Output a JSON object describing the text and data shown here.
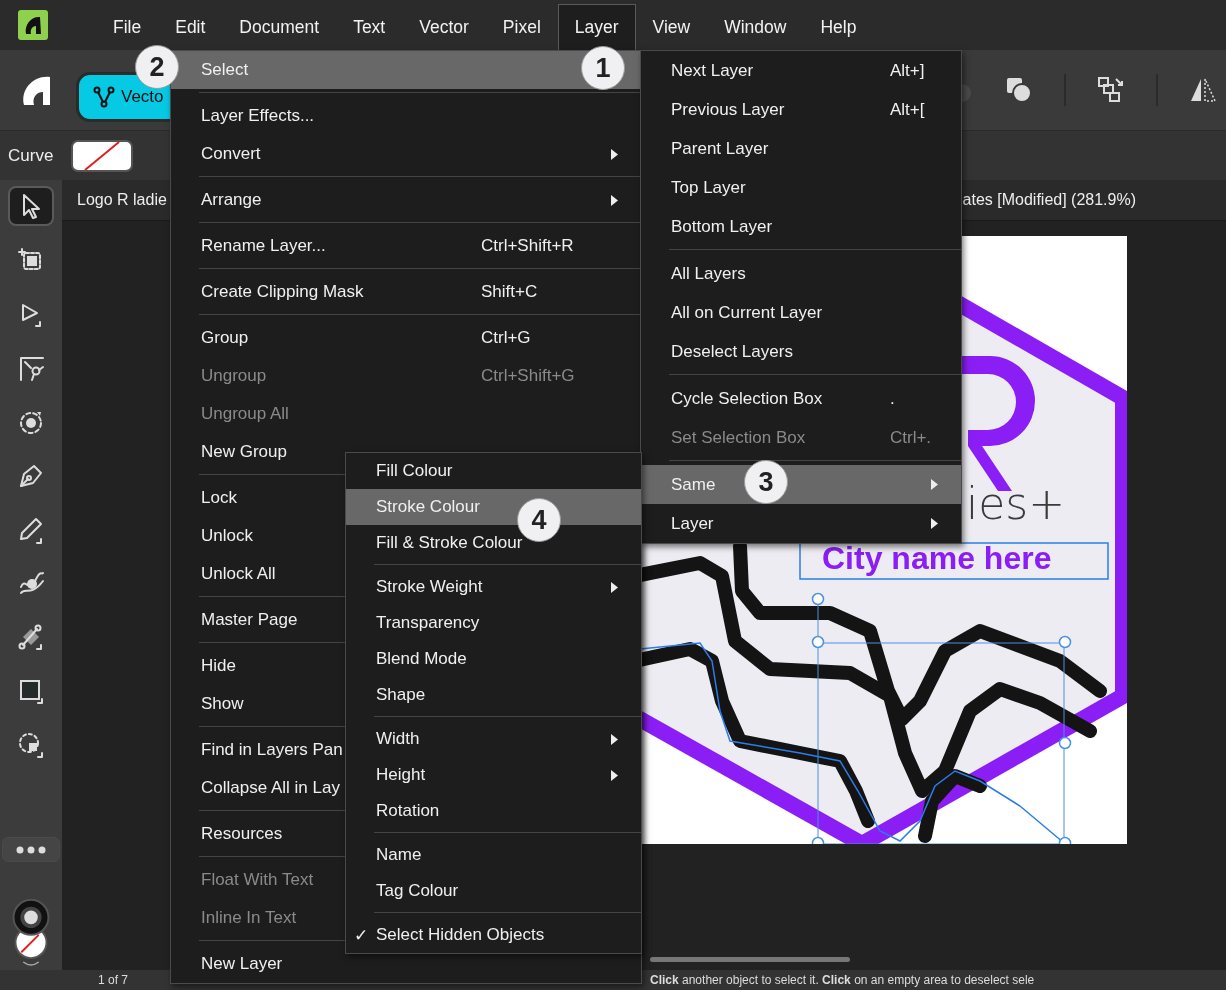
{
  "menu_bar": {
    "items": [
      {
        "label": "File",
        "selected": false
      },
      {
        "label": "Edit",
        "selected": false
      },
      {
        "label": "Document",
        "selected": false
      },
      {
        "label": "Text",
        "selected": false
      },
      {
        "label": "Vector",
        "selected": false
      },
      {
        "label": "Pixel",
        "selected": false
      },
      {
        "label": "Layer",
        "selected": true
      },
      {
        "label": "View",
        "selected": false
      },
      {
        "label": "Window",
        "selected": false
      },
      {
        "label": "Help",
        "selected": false
      }
    ]
  },
  "toolbar": {
    "persona_button": "Vecto"
  },
  "context_bar": {
    "tool_label": "Curve"
  },
  "tools": [
    {
      "kind": "move",
      "selected": true
    },
    {
      "kind": "artboard",
      "selected": false
    },
    {
      "kind": "node",
      "selected": false
    },
    {
      "kind": "corner",
      "selected": false
    },
    {
      "kind": "point",
      "selected": false
    },
    {
      "kind": "pen",
      "selected": false
    },
    {
      "kind": "pencil",
      "selected": false
    },
    {
      "kind": "vector-brush",
      "selected": false
    },
    {
      "kind": "gradient",
      "selected": false
    },
    {
      "kind": "rectangle",
      "selected": false
    },
    {
      "kind": "selection",
      "selected": false
    }
  ],
  "document_tabs": {
    "left_title": "Logo R ladie",
    "right_title": "ates [Modified] (281.9%)"
  },
  "layer_menu": {
    "items": [
      {
        "kind": "item",
        "label": "Select",
        "selected": true,
        "disabled": false
      },
      {
        "kind": "separator"
      },
      {
        "kind": "item",
        "label": "Layer Effects...",
        "selected": false,
        "disabled": false
      },
      {
        "kind": "item",
        "label": "Convert",
        "selected": false,
        "disabled": false,
        "has_submenu": true
      },
      {
        "kind": "separator"
      },
      {
        "kind": "item",
        "label": "Arrange",
        "selected": false,
        "disabled": false,
        "has_submenu": true
      },
      {
        "kind": "separator"
      },
      {
        "kind": "item",
        "label": "Rename Layer...",
        "shortcut": "Ctrl+Shift+R",
        "selected": false,
        "disabled": false
      },
      {
        "kind": "separator"
      },
      {
        "kind": "item",
        "label": "Create Clipping Mask",
        "shortcut": "Shift+C",
        "selected": false,
        "disabled": false
      },
      {
        "kind": "separator"
      },
      {
        "kind": "item",
        "label": "Group",
        "shortcut": "Ctrl+G",
        "selected": false,
        "disabled": false
      },
      {
        "kind": "item",
        "label": "Ungroup",
        "shortcut": "Ctrl+Shift+G",
        "selected": false,
        "disabled": true
      },
      {
        "kind": "item",
        "label": "Ungroup All",
        "selected": false,
        "disabled": true
      },
      {
        "kind": "item",
        "label": "New Group",
        "selected": false,
        "disabled": false
      },
      {
        "kind": "separator"
      },
      {
        "kind": "item",
        "label": "Lock",
        "selected": false,
        "disabled": false
      },
      {
        "kind": "item",
        "label": "Unlock",
        "selected": false,
        "disabled": false
      },
      {
        "kind": "item",
        "label": "Unlock All",
        "selected": false,
        "disabled": false
      },
      {
        "kind": "separator"
      },
      {
        "kind": "item",
        "label": "Master Page",
        "selected": false,
        "disabled": false
      },
      {
        "kind": "separator"
      },
      {
        "kind": "item",
        "label": "Hide",
        "selected": false,
        "disabled": false
      },
      {
        "kind": "item",
        "label": "Show",
        "selected": false,
        "disabled": false
      },
      {
        "kind": "separator"
      },
      {
        "kind": "item",
        "label": "Find in Layers Pan",
        "selected": false,
        "disabled": false
      },
      {
        "kind": "item",
        "label": "Collapse All in Lay",
        "selected": false,
        "disabled": false
      },
      {
        "kind": "separator"
      },
      {
        "kind": "item",
        "label": "Resources",
        "selected": false,
        "disabled": false
      },
      {
        "kind": "separator"
      },
      {
        "kind": "item",
        "label": "Float With Text",
        "selected": false,
        "disabled": true
      },
      {
        "kind": "item",
        "label": "Inline In Text",
        "selected": false,
        "disabled": true
      },
      {
        "kind": "separator"
      },
      {
        "kind": "item",
        "label": "New Layer",
        "selected": false,
        "disabled": false
      }
    ]
  },
  "select_submenu": {
    "items": [
      {
        "kind": "item",
        "label": "Next Layer",
        "shortcut": "Alt+]",
        "selected": false,
        "disabled": false
      },
      {
        "kind": "item",
        "label": "Previous Layer",
        "shortcut": "Alt+[",
        "selected": false,
        "disabled": false
      },
      {
        "kind": "item",
        "label": "Parent Layer",
        "selected": false,
        "disabled": false
      },
      {
        "kind": "item",
        "label": "Top Layer",
        "selected": false,
        "disabled": false
      },
      {
        "kind": "item",
        "label": "Bottom Layer",
        "selected": false,
        "disabled": false
      },
      {
        "kind": "separator"
      },
      {
        "kind": "item",
        "label": "All Layers",
        "selected": false,
        "disabled": false
      },
      {
        "kind": "item",
        "label": "All on Current Layer",
        "selected": false,
        "disabled": false
      },
      {
        "kind": "item",
        "label": "Deselect Layers",
        "selected": false,
        "disabled": false
      },
      {
        "kind": "separator"
      },
      {
        "kind": "item",
        "label": "Cycle Selection Box",
        "shortcut": ".",
        "selected": false,
        "disabled": false
      },
      {
        "kind": "item",
        "label": "Set Selection Box",
        "shortcut": "Ctrl+.",
        "selected": false,
        "disabled": true
      },
      {
        "kind": "separator"
      },
      {
        "kind": "item",
        "label": "Same",
        "selected": true,
        "disabled": false,
        "has_submenu": true
      },
      {
        "kind": "item",
        "label": "Layer",
        "selected": false,
        "disabled": false,
        "has_submenu": true
      }
    ]
  },
  "same_submenu": {
    "check_glyph": "✓",
    "items": [
      {
        "kind": "item",
        "label": "Fill Colour",
        "selected": false,
        "disabled": false
      },
      {
        "kind": "item",
        "label": "Stroke Colour",
        "selected": true,
        "disabled": false
      },
      {
        "kind": "item",
        "label": "Fill & Stroke Colour",
        "selected": false,
        "disabled": false
      },
      {
        "kind": "separator"
      },
      {
        "kind": "item",
        "label": "Stroke Weight",
        "selected": false,
        "disabled": false,
        "has_submenu": true
      },
      {
        "kind": "item",
        "label": "Transparency",
        "selected": false,
        "disabled": false
      },
      {
        "kind": "item",
        "label": "Blend Mode",
        "selected": false,
        "disabled": false
      },
      {
        "kind": "item",
        "label": "Shape",
        "selected": false,
        "disabled": false
      },
      {
        "kind": "separator"
      },
      {
        "kind": "item",
        "label": "Width",
        "selected": false,
        "disabled": false,
        "has_submenu": true
      },
      {
        "kind": "item",
        "label": "Height",
        "selected": false,
        "disabled": false,
        "has_submenu": true
      },
      {
        "kind": "item",
        "label": "Rotation",
        "selected": false,
        "disabled": false
      },
      {
        "kind": "separator"
      },
      {
        "kind": "item",
        "label": "Name",
        "selected": false,
        "disabled": false
      },
      {
        "kind": "item",
        "label": "Tag Colour",
        "selected": false,
        "disabled": false
      },
      {
        "kind": "separator"
      },
      {
        "kind": "item",
        "label": "Select Hidden Objects",
        "selected": false,
        "disabled": false,
        "checked": true
      }
    ]
  },
  "callouts": [
    "1",
    "2",
    "3",
    "4"
  ],
  "artwork": {
    "logo_text": "ies+",
    "city_text": "City name here"
  },
  "status_bar": {
    "page": "1 of 7",
    "hint": "**Click** another object to select it. **Click** on an empty area to deselect sele"
  }
}
